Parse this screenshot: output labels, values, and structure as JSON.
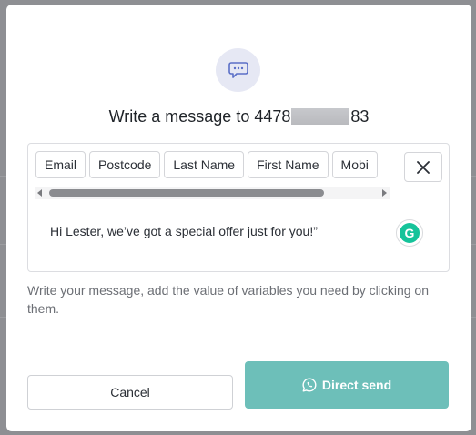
{
  "dialog": {
    "title_prefix": "Write a message to 4478",
    "title_suffix": "83",
    "header_icon": "chat-bubble-icon"
  },
  "variables": {
    "chips": [
      "Email",
      "Postcode",
      "Last Name",
      "First Name",
      "Mobi"
    ]
  },
  "editor": {
    "message": "Hi  Lester, we’ve got a special offer just for you!”",
    "grammarly_letter": "G"
  },
  "helper_text": "Write your message, add the value of variables you need by clicking on them.",
  "actions": {
    "cancel_label": "Cancel",
    "send_label": "Direct send",
    "send_icon": "whatsapp-icon"
  },
  "colors": {
    "accent": "#6dbfb9",
    "icon_tint": "#5b6fc7"
  }
}
